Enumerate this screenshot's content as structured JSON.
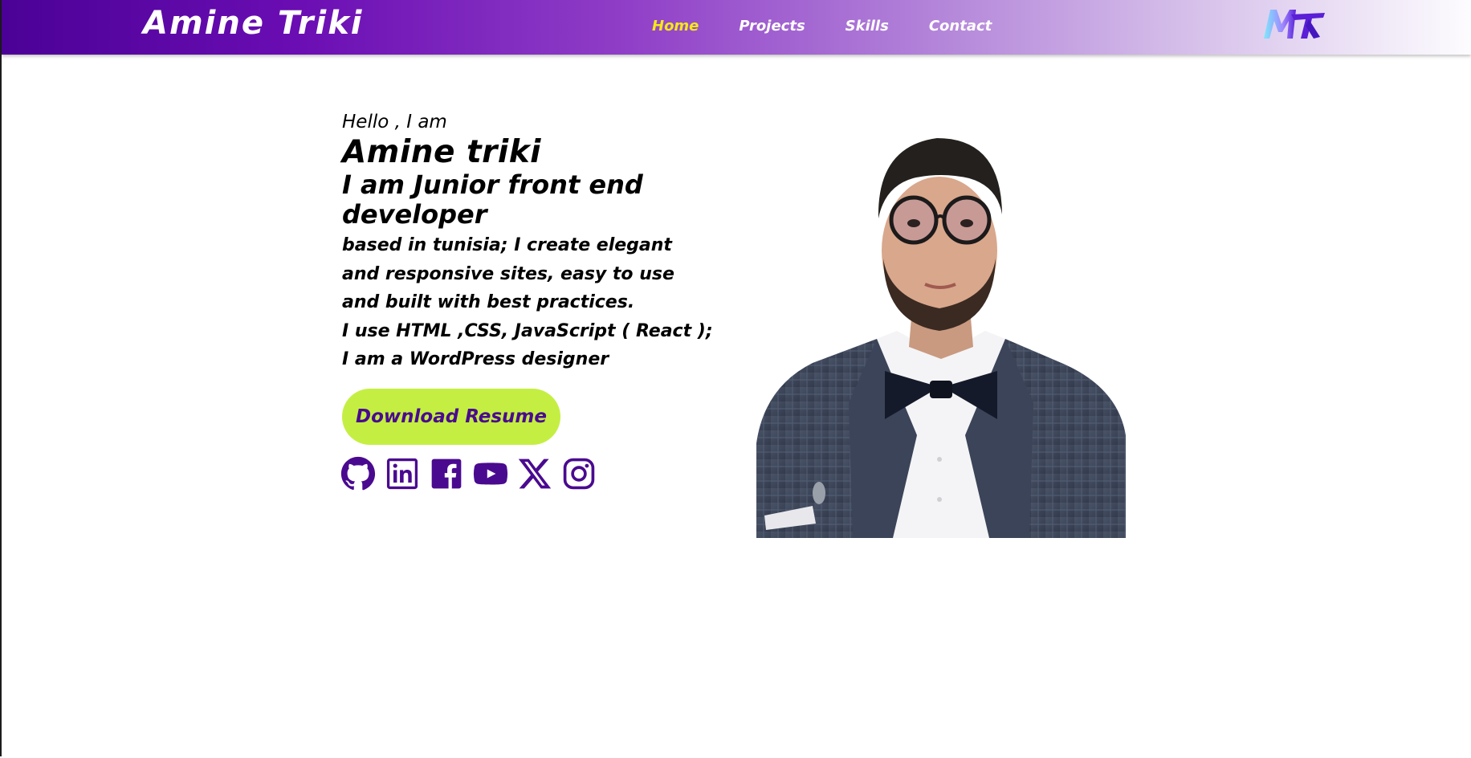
{
  "header": {
    "brand": "Amine Triki",
    "nav": [
      {
        "label": "Home",
        "active": true
      },
      {
        "label": "Projects",
        "active": false
      },
      {
        "label": "Skills",
        "active": false
      },
      {
        "label": "Contact",
        "active": false
      }
    ],
    "logo_text": "MT"
  },
  "hero": {
    "greeting": "Hello , I am",
    "name": "Amine triki",
    "role": "I am Junior front end developer",
    "description_lines": [
      "based in tunisia; I create elegant",
      "and responsive sites, easy to use",
      "and built with best practices.",
      "I use HTML ,CSS, JavaScript ( React );",
      "I am a WordPress designer"
    ],
    "download_label": "Download Resume"
  },
  "socials": [
    {
      "icon": "github-icon"
    },
    {
      "icon": "linkedin-icon"
    },
    {
      "icon": "facebook-icon"
    },
    {
      "icon": "youtube-icon"
    },
    {
      "icon": "x-twitter-icon"
    },
    {
      "icon": "instagram-icon"
    }
  ],
  "colors": {
    "nav_gradient_start": "#4b0196",
    "nav_gradient_end": "#fdfcfe",
    "active_nav": "#f5e916",
    "button_bg": "#c4ef42",
    "button_text": "#4a0a90",
    "icon_color": "#4a0a90"
  }
}
